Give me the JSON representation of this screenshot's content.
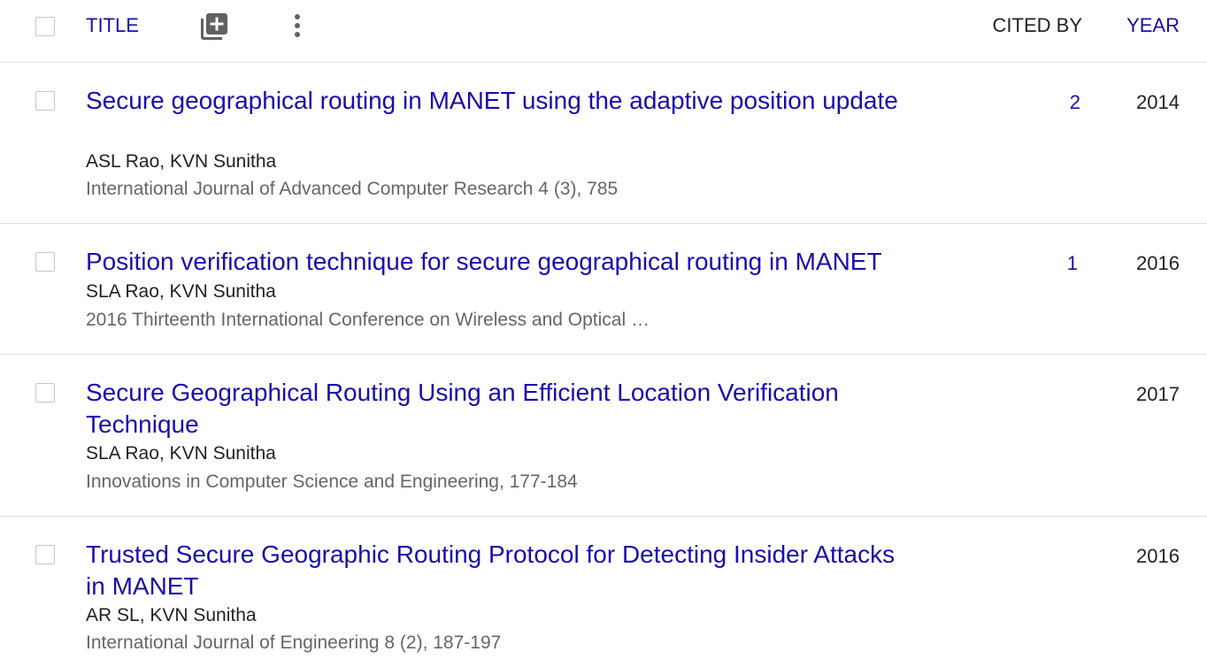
{
  "header": {
    "title_label": "TITLE",
    "add_icon": "library-add-icon",
    "more_icon": "more-vert-icon",
    "cited_by_label": "CITED BY",
    "year_label": "YEAR"
  },
  "colors": {
    "link": "#1a0dab",
    "text": "#222222",
    "muted": "#666666",
    "divider": "#e0e0e0"
  },
  "articles": [
    {
      "title": "Secure geographical routing in MANET using the adaptive position update",
      "authors": "ASL Rao, KVN Sunitha",
      "venue": "International Journal of Advanced Computer Research 4 (3), 785",
      "cited_by": "2",
      "year": "2014"
    },
    {
      "title": "Position verification technique for secure geographical routing in MANET",
      "authors": "SLA Rao, KVN Sunitha",
      "venue": "2016 Thirteenth International Conference on Wireless and Optical …",
      "cited_by": "1",
      "year": "2016"
    },
    {
      "title": "Secure Geographical Routing Using an Efficient Location Verification Technique",
      "authors": "SLA Rao, KVN Sunitha",
      "venue": "Innovations in Computer Science and Engineering, 177-184",
      "cited_by": "",
      "year": "2017"
    },
    {
      "title": "Trusted Secure Geographic Routing Protocol for Detecting Insider Attacks in MANET",
      "authors": "AR SL, KVN Sunitha",
      "venue": "International Journal of Engineering 8 (2), 187-197",
      "cited_by": "",
      "year": "2016"
    }
  ]
}
